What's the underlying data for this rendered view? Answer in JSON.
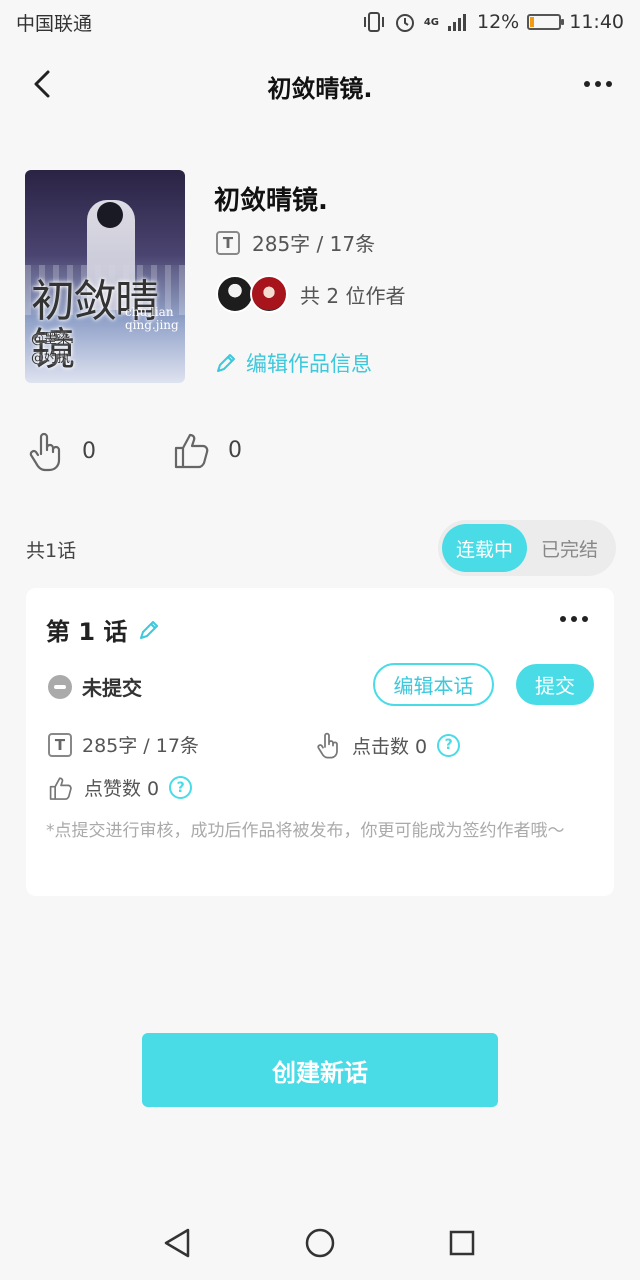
{
  "status_bar": {
    "carrier": "中国联通",
    "battery_percent": "12%",
    "time": "11:40",
    "network": "4G"
  },
  "nav": {
    "title": "初敛晴镜."
  },
  "work": {
    "cover_title": "初敛晴镜",
    "cover_subtitle": "chu.lian qing.jing",
    "cover_authors": "@墨染. @妁执.",
    "title": "初敛晴镜.",
    "word_count": "285字 / 17条",
    "authors_label": "共 2 位作者",
    "edit_info_label": "编辑作品信息"
  },
  "stats": {
    "clicks": "0",
    "likes": "0"
  },
  "episodes": {
    "count_label": "共1话",
    "status_options": [
      "连载中",
      "已完结"
    ],
    "status_selected": "连载中"
  },
  "episode_card": {
    "title": "第 1 话",
    "state": "未提交",
    "edit_button": "编辑本话",
    "submit_button": "提交",
    "word_count": "285字 / 17条",
    "click_label": "点击数 0",
    "like_label": "点赞数 0",
    "note": "*点提交进行审核，成功后作品将被发布，你更可能成为签约作者哦～"
  },
  "actions": {
    "create_label": "创建新话"
  },
  "colors": {
    "accent": "#49dbe6",
    "battery_low": "#f39c12"
  },
  "icons": [
    "back-arrow-icon",
    "more-icon",
    "text-icon",
    "pencil-icon",
    "tap-icon",
    "thumbs-up-icon",
    "help-icon",
    "nav-back-icon",
    "nav-home-icon",
    "nav-recent-icon"
  ]
}
